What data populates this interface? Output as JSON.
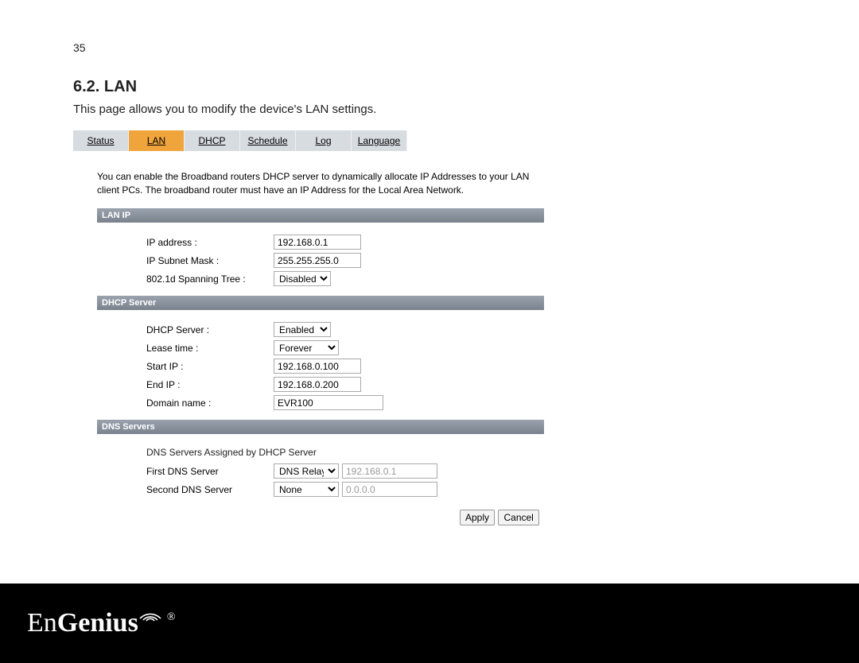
{
  "page_number": "35",
  "section_title": "6.2. LAN",
  "section_desc": "This page allows you to modify the device's LAN settings.",
  "tabs": [
    {
      "label": "Status",
      "active": false
    },
    {
      "label": "LAN",
      "active": true
    },
    {
      "label": "DHCP",
      "active": false
    },
    {
      "label": "Schedule",
      "active": false
    },
    {
      "label": "Log",
      "active": false
    },
    {
      "label": "Language",
      "active": false
    }
  ],
  "help_text": "You can enable the Broadband routers DHCP server to dynamically allocate IP Addresses to your LAN client PCs. The broadband router must have an IP Address for the Local Area Network.",
  "sections": {
    "lan_ip": {
      "title": "LAN IP",
      "rows": {
        "ip_address_label": "IP address :",
        "ip_address_value": "192.168.0.1",
        "subnet_label": "IP Subnet Mask :",
        "subnet_value": "255.255.255.0",
        "spanning_label": "802.1d Spanning Tree :",
        "spanning_value": "Disabled"
      }
    },
    "dhcp": {
      "title": "DHCP Server",
      "rows": {
        "dhcp_server_label": "DHCP Server :",
        "dhcp_server_value": "Enabled",
        "lease_label": "Lease time :",
        "lease_value": "Forever",
        "start_label": "Start IP :",
        "start_value": "192.168.0.100",
        "end_label": "End IP :",
        "end_value": "192.168.0.200",
        "domain_label": "Domain name :",
        "domain_value": "EVR100"
      }
    },
    "dns": {
      "title": "DNS Servers",
      "heading": "DNS Servers Assigned by DHCP Server",
      "rows": {
        "first_label": "First DNS Server",
        "first_select": "DNS Relay",
        "first_value": "192.168.0.1",
        "second_label": "Second DNS Server",
        "second_select": "None",
        "second_value": "0.0.0.0"
      }
    }
  },
  "buttons": {
    "apply": "Apply",
    "cancel": "Cancel"
  },
  "brand": {
    "en": "En",
    "genius": "Genius",
    "reg": "®"
  }
}
